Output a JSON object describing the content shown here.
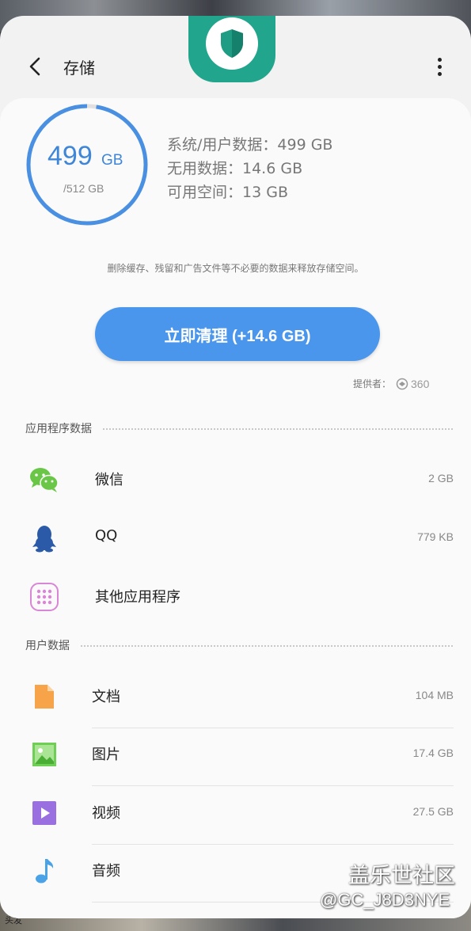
{
  "header": {
    "title": "存储",
    "back_icon": "chevron-left-icon",
    "more_icon": "more-vertical-icon",
    "app_badge_icon": "shield-icon"
  },
  "storage": {
    "used_value": "499",
    "used_unit": "GB",
    "total": "/512 GB",
    "used_fraction": 0.975,
    "ring_color": "#4a90e2",
    "stats": [
      "系统/用户数据：499 GB",
      "无用数据：14.6 GB",
      "可用空间：13 GB"
    ]
  },
  "hint": "删除缓存、残留和广告文件等不必要的数据来释放存储空间。",
  "clean_button": "立即清理 (+14.6 GB)",
  "provider": {
    "label": "提供者：",
    "brand": "360"
  },
  "sections": {
    "apps_title": "应用程序数据",
    "user_title": "用户数据"
  },
  "apps": [
    {
      "label": "微信",
      "size": "2 GB",
      "icon": "wechat-icon"
    },
    {
      "label": "QQ",
      "size": "779 KB",
      "icon": "qq-penguin-icon"
    },
    {
      "label": "其他应用程序",
      "size": "",
      "icon": "apps-grid-icon"
    }
  ],
  "user_data": [
    {
      "label": "文档",
      "size": "104 MB",
      "icon": "document-icon"
    },
    {
      "label": "图片",
      "size": "17.4 GB",
      "icon": "image-icon"
    },
    {
      "label": "视频",
      "size": "27.5 GB",
      "icon": "video-icon"
    },
    {
      "label": "音频",
      "size": "",
      "icon": "music-note-icon"
    }
  ],
  "watermark": {
    "line1": "盖乐世社区",
    "line2": "@GC_J8D3NYE"
  },
  "background_caption": "头发"
}
